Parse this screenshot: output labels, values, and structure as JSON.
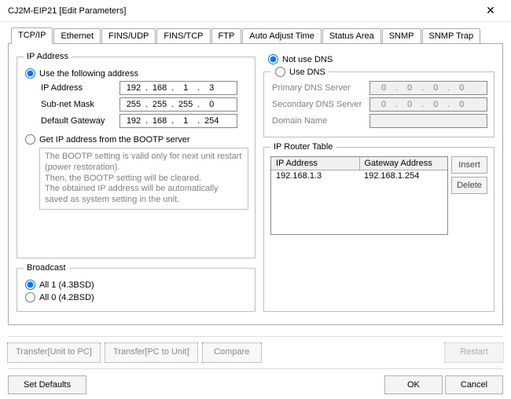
{
  "window": {
    "title": "CJ2M-EIP21 [Edit Parameters]"
  },
  "tabs": {
    "tcpip": "TCP/IP",
    "ethernet": "Ethernet",
    "finsudp": "FINS/UDP",
    "finstcp": "FINS/TCP",
    "ftp": "FTP",
    "autoadjust": "Auto Adjust Time",
    "statusarea": "Status Area",
    "snmp": "SNMP",
    "snmptrap": "SNMP Trap"
  },
  "ipaddress": {
    "legend": "IP Address",
    "radio_use_following": "Use the following address",
    "radio_bootp": "Get IP address from the BOOTP server",
    "labels": {
      "ip": "IP Address",
      "mask": "Sub-net Mask",
      "gateway": "Default Gateway"
    },
    "ip": {
      "o1": "192",
      "o2": "168",
      "o3": "1",
      "o4": "3"
    },
    "mask": {
      "o1": "255",
      "o2": "255",
      "o3": "255",
      "o4": "0"
    },
    "gateway": {
      "o1": "192",
      "o2": "168",
      "o3": "1",
      "o4": "254"
    },
    "bootp_note": "The BOOTP setting is valid only for next unit restart (power restoration).\nThen, the BOOTP setting will be cleared.\nThe obtained IP address will be automatically saved as system setting in the unit."
  },
  "broadcast": {
    "legend": "Broadcast",
    "opt1": "All 1 (4.3BSD)",
    "opt0": "All 0 (4.2BSD)"
  },
  "dns": {
    "radio_notuse": "Not use DNS",
    "radio_use": "Use DNS",
    "labels": {
      "primary": "Primary DNS Server",
      "secondary": "Secondary DNS Server",
      "domain": "Domain Name"
    },
    "primary": {
      "o1": "0",
      "o2": "0",
      "o3": "0",
      "o4": "0"
    },
    "secondary": {
      "o1": "0",
      "o2": "0",
      "o3": "0",
      "o4": "0"
    }
  },
  "router": {
    "legend": "IP Router Table",
    "headers": {
      "ip": "IP Address",
      "gw": "Gateway Address"
    },
    "rows": [
      {
        "ip": "192.168.1.3",
        "gw": "192.168.1.254"
      }
    ],
    "row0": {
      "ip": "192.168.1.3",
      "gw": "192.168.1.254"
    },
    "buttons": {
      "insert": "Insert",
      "delete": "Delete"
    }
  },
  "buttons": {
    "transfer_unit_to_pc": "Transfer[Unit to PC]",
    "transfer_pc_to_unit": "Transfer[PC to Unit]",
    "compare": "Compare",
    "restart": "Restart",
    "set_defaults": "Set Defaults",
    "ok": "OK",
    "cancel": "Cancel"
  }
}
